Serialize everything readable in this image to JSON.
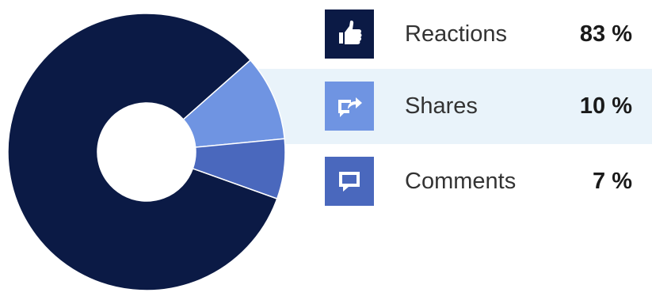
{
  "chart_data": {
    "type": "pie",
    "variant": "donut",
    "unit": "%",
    "categories": [
      "Reactions",
      "Shares",
      "Comments"
    ],
    "values": [
      83,
      10,
      7
    ],
    "colors": [
      "#0b1a45",
      "#6f94e2",
      "#4a68bd"
    ],
    "value_labels": [
      "83 %",
      "10 %",
      "7 %"
    ],
    "legend_position": "right",
    "icons": [
      "thumbs-up-icon",
      "share-icon",
      "comment-icon"
    ],
    "highlighted_category": "Shares",
    "highlight_color": "#e9f3fa"
  }
}
